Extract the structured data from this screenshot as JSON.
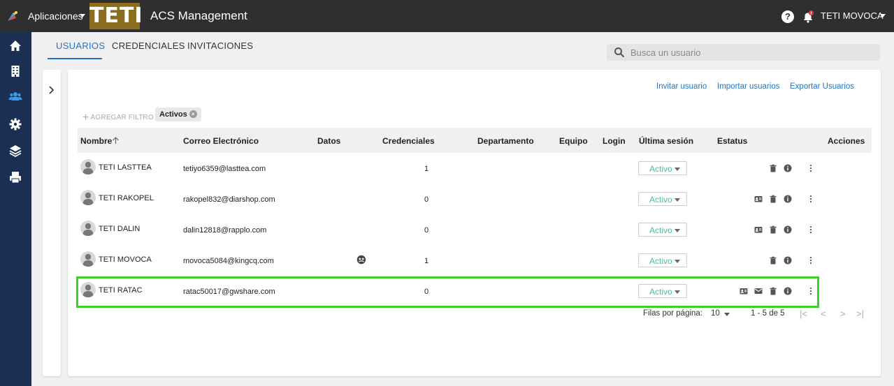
{
  "header": {
    "apps_label": "Aplicaciones",
    "logo_text": "TETI",
    "app_title": "ACS Management",
    "help_label": "?",
    "user_name": "TETI MOVOCA"
  },
  "tabs": [
    {
      "label": "USUARIOS",
      "active": true
    },
    {
      "label": "CREDENCIALES",
      "active": false
    },
    {
      "label": "INVITACIONES",
      "active": false
    }
  ],
  "search": {
    "placeholder": "Busca un usuario",
    "value": ""
  },
  "actions": {
    "invite": "Invitar usuario",
    "import": "Importar usuarios",
    "export": "Exportar Usuarios"
  },
  "filters": {
    "add_label": "AGREGAR FILTRO",
    "active_chip": "Activos"
  },
  "table": {
    "headers": {
      "name": "Nombre",
      "email": "Correo Electrónico",
      "data": "Datos",
      "credentials": "Credenciales",
      "department": "Departamento",
      "team": "Equipo",
      "login": "Login",
      "last_session": "Última sesión",
      "status": "Estatus",
      "actions": "Acciones"
    },
    "rows": [
      {
        "name": "TETI LASTTEA",
        "email": "tetiyo6359@lasttea.com",
        "credentials": "1",
        "status": "Activo",
        "icons": [
          "trash-icon",
          "info-icon",
          "more-icon"
        ]
      },
      {
        "name": "TETI RAKOPEL",
        "email": "rakopel832@diarshop.com",
        "credentials": "0",
        "status": "Activo",
        "icons": [
          "id-card-icon",
          "trash-icon",
          "info-icon",
          "more-icon"
        ]
      },
      {
        "name": "TETI DALIN",
        "email": "dalin12818@rapplo.com",
        "credentials": "0",
        "status": "Activo",
        "icons": [
          "id-card-icon",
          "trash-icon",
          "info-icon",
          "more-icon"
        ]
      },
      {
        "name": "TETI MOVOCA",
        "email": "movoca5084@kingcq.com",
        "credentials": "1",
        "status": "Activo",
        "data_icon": "face-icon",
        "icons": [
          "trash-icon",
          "info-icon",
          "more-icon"
        ]
      },
      {
        "name": "TETI RATAC",
        "email": "ratac50017@gwshare.com",
        "credentials": "0",
        "status": "Activo",
        "highlighted": true,
        "icons": [
          "id-card-icon",
          "mail-icon",
          "trash-icon",
          "info-icon",
          "more-icon"
        ]
      }
    ]
  },
  "pagination": {
    "rows_per_page_label": "Filas por página:",
    "rows_per_page_value": "10",
    "range": "1 - 5 de 5"
  },
  "colors": {
    "topbar": "#2f2f2f",
    "sidebar": "#1b2f54",
    "accent": "#1e74c9",
    "status_green": "#4cc08a",
    "highlight": "#3bd12a",
    "logo_bg": "#8b6d1f"
  }
}
